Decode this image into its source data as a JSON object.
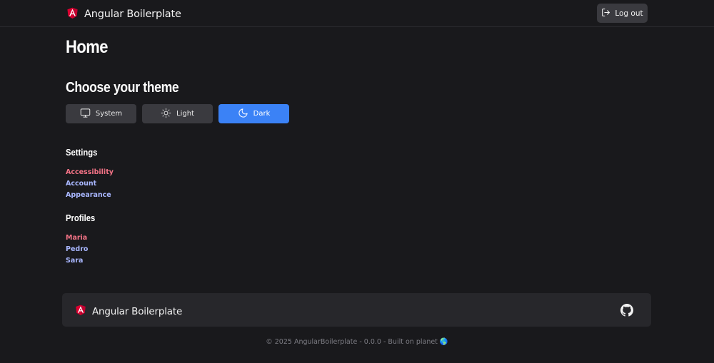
{
  "header": {
    "brand": "Angular Boilerplate",
    "logout_label": "Log out"
  },
  "page": {
    "title": "Home",
    "theme_heading": "Choose your theme"
  },
  "themes": [
    {
      "label": "System",
      "icon": "monitor-icon",
      "active": false
    },
    {
      "label": "Light",
      "icon": "sun-icon",
      "active": false
    },
    {
      "label": "Dark",
      "icon": "moon-icon",
      "active": true
    }
  ],
  "settings": {
    "heading": "Settings",
    "items": [
      "Accessibility",
      "Account",
      "Appearance"
    ]
  },
  "profiles": {
    "heading": "Profiles",
    "items": [
      "Maria",
      "Pedro",
      "Sara"
    ]
  },
  "footer": {
    "brand": "Angular Boilerplate",
    "copyright": "© 2025 AngularBoilerplate - 0.0.0 - Built on planet 🌎"
  },
  "colors": {
    "background": "#19191c",
    "accent": "#3b82f6",
    "angular_red": "#dd0031",
    "link_pink": "#f47386",
    "link_lavender": "#a9b7ff"
  }
}
